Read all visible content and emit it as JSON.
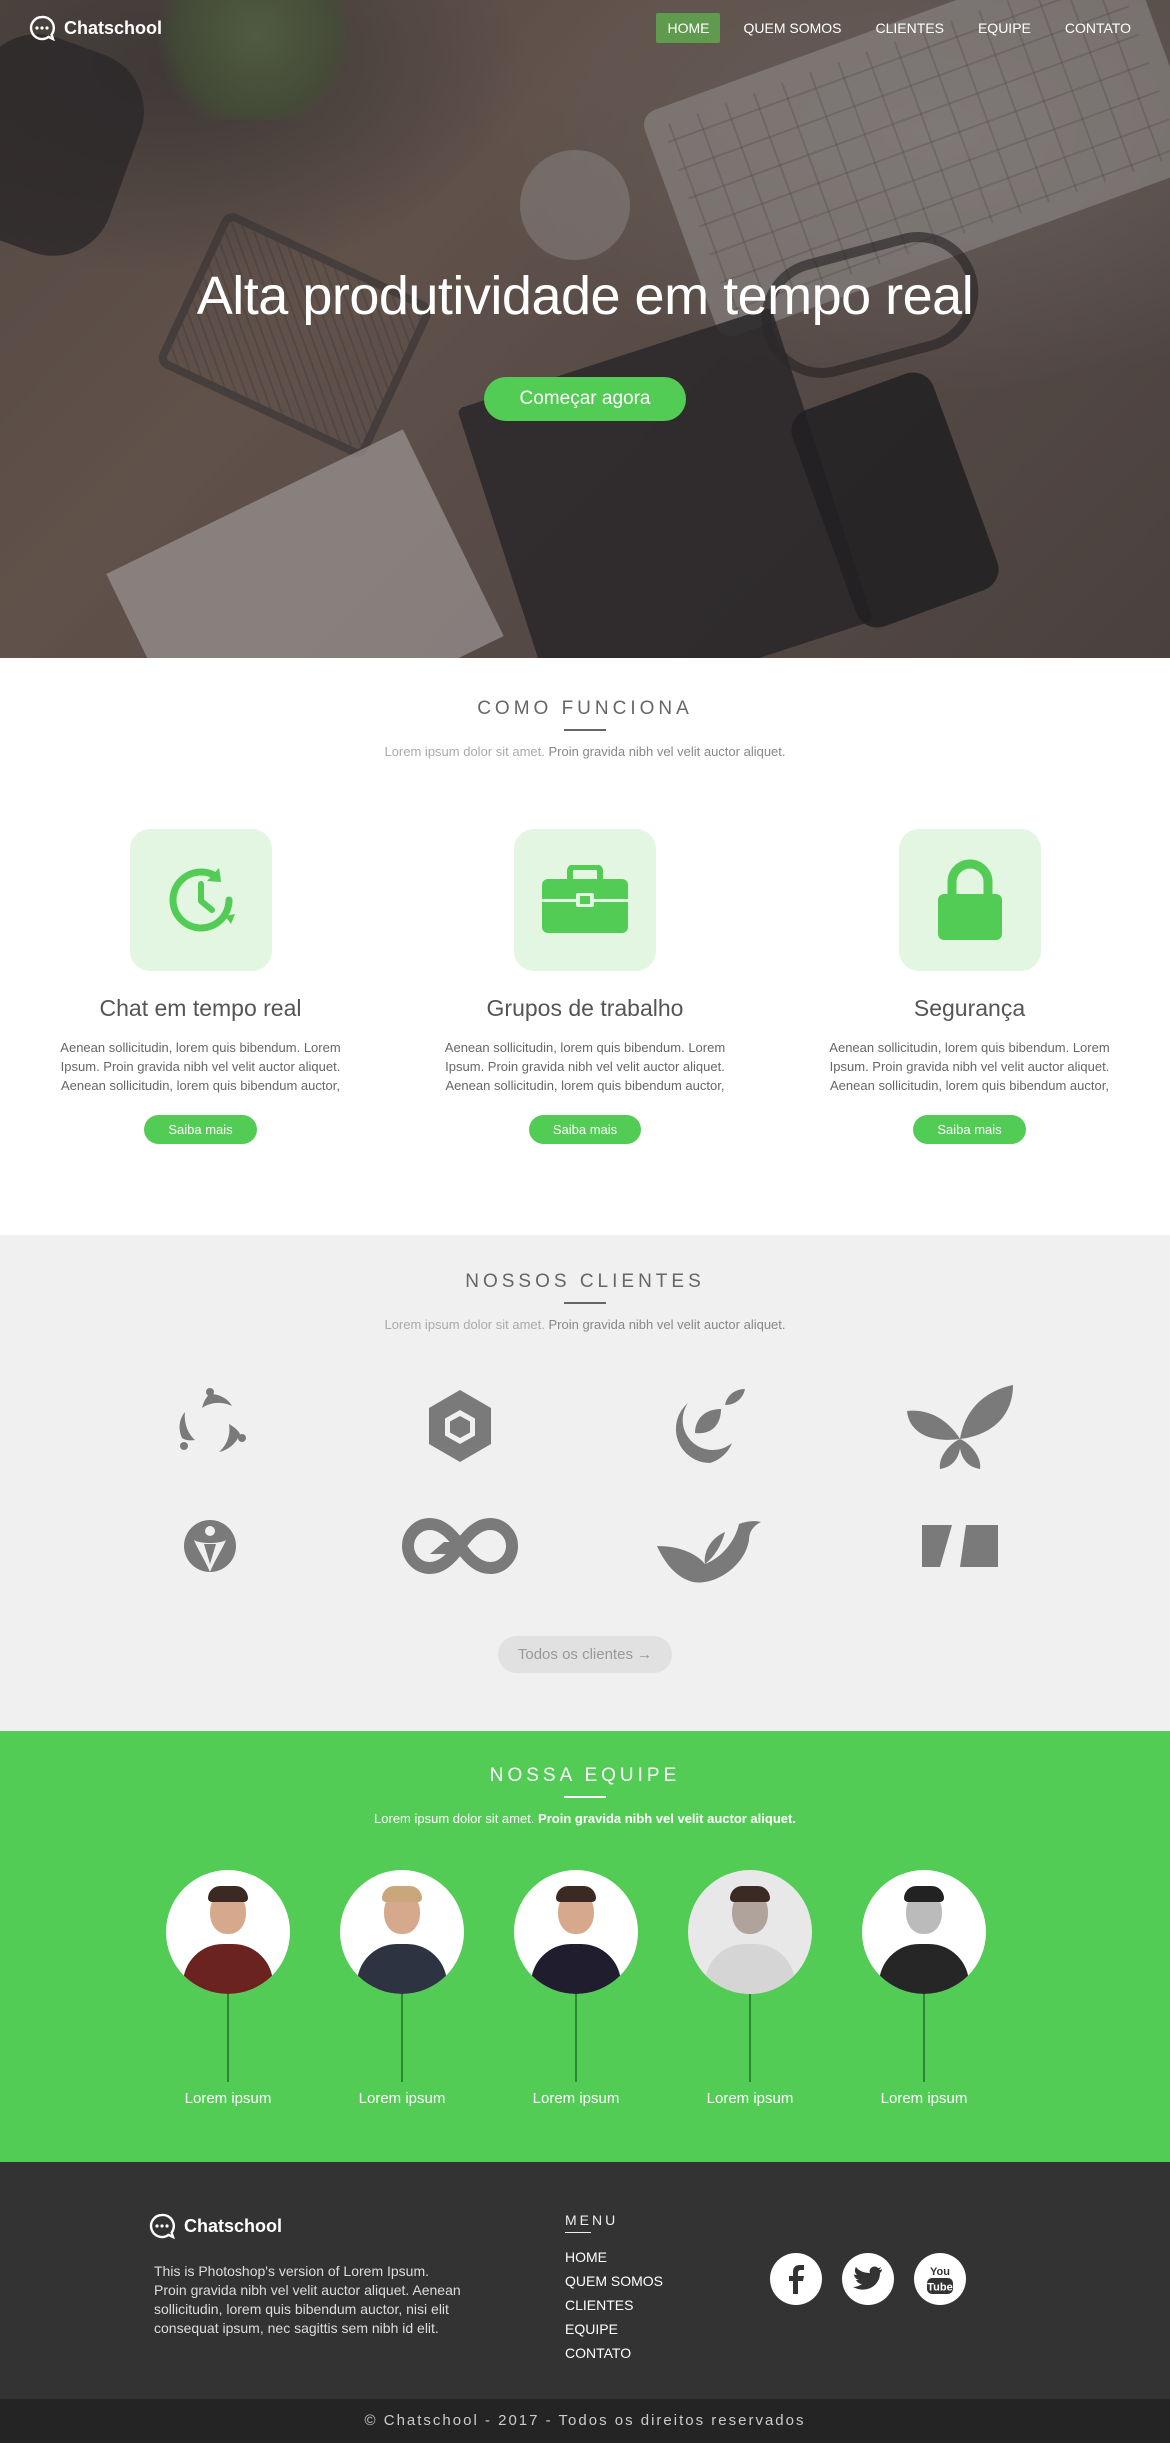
{
  "brand": {
    "name": "Chatschool"
  },
  "nav": {
    "items": [
      {
        "label": "HOME",
        "active": true
      },
      {
        "label": "QUEM SOMOS"
      },
      {
        "label": "CLIENTES"
      },
      {
        "label": "EQUIPE"
      },
      {
        "label": "CONTATO"
      }
    ]
  },
  "hero": {
    "title": "Alta produtividade em tempo real",
    "cta": "Começar agora"
  },
  "how": {
    "title": "COMO FUNCIONA",
    "subtitle_light": "Lorem ipsum dolor sit amet. ",
    "subtitle_dark": "Proin gravida nibh vel velit auctor aliquet.",
    "features": [
      {
        "icon": "clock-refresh-icon",
        "title": "Chat em tempo real",
        "text": "Aenean sollicitudin, lorem quis bibendum. Lorem Ipsum. Proin gravida nibh vel velit auctor aliquet. Aenean sollicitudin, lorem quis bibendum auctor,",
        "button": "Saiba mais"
      },
      {
        "icon": "briefcase-icon",
        "title": "Grupos de trabalho",
        "text": "Aenean sollicitudin, lorem quis bibendum. Lorem Ipsum. Proin gravida nibh vel velit auctor aliquet. Aenean sollicitudin, lorem quis bibendum auctor,",
        "button": "Saiba mais"
      },
      {
        "icon": "padlock-icon",
        "title": "Segurança",
        "text": "Aenean sollicitudin, lorem quis bibendum. Lorem Ipsum. Proin gravida nibh vel velit auctor aliquet. Aenean sollicitudin, lorem quis bibendum auctor,",
        "button": "Saiba mais"
      }
    ]
  },
  "clients": {
    "title": "NOSSOS CLIENTES",
    "subtitle_light": "Lorem ipsum dolor sit amet. ",
    "subtitle_dark": "Proin gravida nibh vel velit auctor aliquet.",
    "button": "Todos os clientes →",
    "logos": [
      "circle-swirl-logo",
      "hexagon-logo",
      "leaf-orbit-logo",
      "leaves-logo",
      "person-circle-logo",
      "infinity-logo",
      "bird-logo",
      "n-block-logo"
    ]
  },
  "team": {
    "title": "NOSSA EQUIPE",
    "subtitle_light": "Lorem ipsum dolor sit amet. ",
    "subtitle_dark": "Proin gravida nibh vel velit auctor aliquet.",
    "members": [
      {
        "name": "Lorem ipsum",
        "shirt": "#6b2320"
      },
      {
        "name": "Lorem ipsum",
        "shirt": "#2d3340"
      },
      {
        "name": "Lorem ipsum",
        "shirt": "#1f1d2e"
      },
      {
        "name": "Lorem ipsum",
        "shirt": "#d5d5d5"
      },
      {
        "name": "Lorem ipsum",
        "shirt": "#262626"
      }
    ]
  },
  "footer": {
    "about": "This is Photoshop's version  of Lorem Ipsum. Proin gravida nibh vel velit auctor aliquet. Aenean sollicitudin, lorem quis bibendum auctor, nisi elit consequat ipsum, nec sagittis sem nibh id elit.",
    "menu_title": "MENU",
    "links": [
      "HOME",
      "QUEM SOMOS",
      "CLIENTES",
      "EQUIPE",
      "CONTATO"
    ],
    "socials": [
      {
        "icon": "facebook-icon",
        "glyph": "f"
      },
      {
        "icon": "twitter-icon",
        "glyph": "t"
      },
      {
        "icon": "youtube-icon",
        "glyph": "You Tube"
      }
    ],
    "copyright": "© Chatschool - 2017 - Todos os direitos reservados"
  },
  "colors": {
    "accent": "#52cc55",
    "dark": "#333333",
    "light_bg": "#f0f0f0"
  }
}
